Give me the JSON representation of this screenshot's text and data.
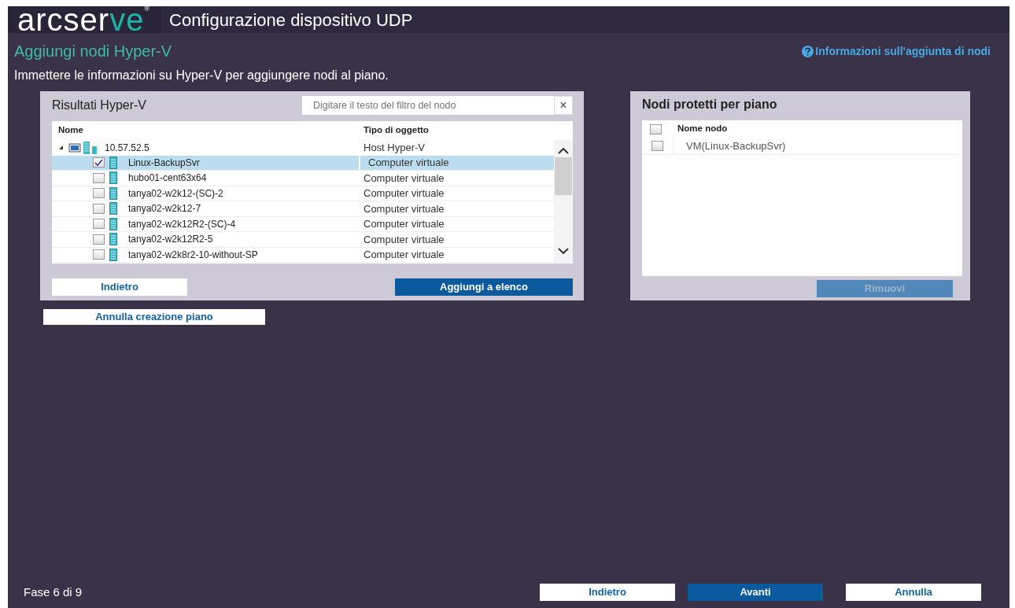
{
  "header": {
    "logo": {
      "text": "arcser",
      "accent": "ve",
      "mark": "®"
    },
    "title": "Configurazione dispositivo UDP"
  },
  "page": {
    "title": "Aggiungi nodi Hyper-V",
    "help_link": "Informazioni sull'aggiunta di nodi",
    "description": "Immettere le informazioni su Hyper-V per aggiungere nodi al piano."
  },
  "results_panel": {
    "title": "Risultati Hyper-V",
    "filter": {
      "placeholder": "Digitare il testo del filtro del nodo",
      "clear": "×"
    },
    "columns": [
      "Nome",
      "Tipo di oggetto"
    ],
    "tree": [
      {
        "name": "10.57.52.5",
        "type": "Host Hyper-V",
        "expanded": true,
        "children": [
          {
            "name": "Linux-BackupSvr",
            "type": "Computer virtuale",
            "checked": true,
            "selected": true
          },
          {
            "name": "hubo01-cent63x64",
            "type": "Computer virtuale",
            "checked": false,
            "selected": false
          },
          {
            "name": "tanya02-w2k12-(SC)-2",
            "type": "Computer virtuale",
            "checked": false,
            "selected": false
          },
          {
            "name": "tanya02-w2k12-7",
            "type": "Computer virtuale",
            "checked": false,
            "selected": false
          },
          {
            "name": "tanya02-w2k12R2-(SC)-4",
            "type": "Computer virtuale",
            "checked": false,
            "selected": false
          },
          {
            "name": "tanya02-w2k12R2-5",
            "type": "Computer virtuale",
            "checked": false,
            "selected": false
          },
          {
            "name": "tanya02-w2k8r2-10-without-SP",
            "type": "Computer virtuale",
            "checked": false,
            "selected": false
          }
        ]
      }
    ],
    "buttons": [
      {
        "label": "Indietro",
        "kind": "secondary"
      },
      {
        "label": "Aggiungi a elenco",
        "kind": "primary"
      }
    ]
  },
  "protected_panel": {
    "title": "Nodi protetti per piano",
    "header_checked": false,
    "column": "Nome nodo",
    "rows": [
      {
        "name": "VM(Linux-BackupSvr)",
        "checked": false
      }
    ],
    "remove_button": {
      "label": "Rimuovi",
      "disabled": true
    }
  },
  "cancel_plan_button": "Annulla creazione piano",
  "footer": {
    "step": "Fase 6 di 9",
    "buttons": [
      {
        "label": "Indietro",
        "kind": "secondary"
      },
      {
        "label": "Avanti",
        "kind": "primary"
      },
      {
        "label": "Annulla",
        "kind": "secondary"
      }
    ]
  }
}
